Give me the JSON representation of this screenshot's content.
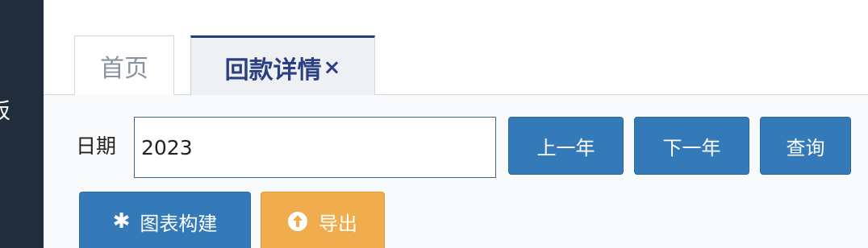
{
  "sidebar": {
    "partial_label": "板"
  },
  "tabs": [
    {
      "label": "首页"
    },
    {
      "label": "回款详情",
      "close_glyph": "×"
    }
  ],
  "filter": {
    "date_label": "日期",
    "date_value": "2023"
  },
  "buttons": {
    "prev_year": "上一年",
    "next_year": "下一年",
    "query": "查询",
    "build_chart": "图表构建",
    "export": "导出"
  },
  "icons": {
    "build_chart": "asterisk-icon",
    "export": "upload-circle-icon"
  },
  "colors": {
    "sidebar": "#222d3c",
    "primary_button": "#3479b8",
    "warning_button": "#f1ad4d",
    "active_tab_text": "#2d3f83"
  }
}
